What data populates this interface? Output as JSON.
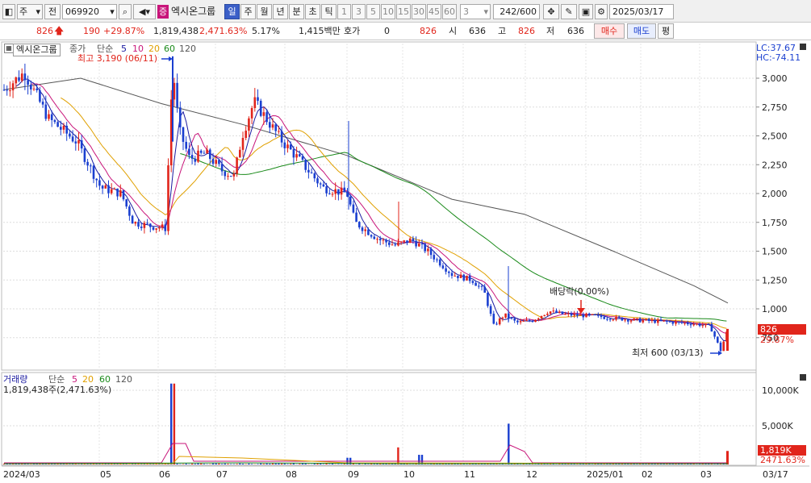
{
  "toolbar": {
    "market_type": "주",
    "market_sub": "전",
    "code": "069920",
    "stock_name": "엑시온그룹",
    "name_badge": "증",
    "period_buttons": [
      "일",
      "주",
      "월",
      "년",
      "분",
      "초",
      "틱"
    ],
    "interval_buttons": [
      "1",
      "3",
      "5",
      "10",
      "15",
      "30",
      "45",
      "60"
    ],
    "interval_select": "3",
    "count": "242",
    "count_max": "/600",
    "date": "2025/03/17"
  },
  "quote": {
    "price": "826",
    "change": "190",
    "change_pct": "+29.87%",
    "volume": "1,819,438",
    "volume_pct": "2,471.63%",
    "turnover": "5.17%",
    "amount": "1,415백만",
    "hoga_label": "호가",
    "hoga_value": "0",
    "hoga_price": "826",
    "open_label": "시",
    "open": "636",
    "high_label": "고",
    "high": "826",
    "low_label": "저",
    "low": "636",
    "buy": "매수",
    "sell": "매도",
    "avg": "평"
  },
  "price_panel": {
    "legend_name": "엑시온그룹",
    "legend_close": "종가",
    "legend_simple": "단순",
    "ma": [
      "5",
      "10",
      "20",
      "60",
      "120"
    ],
    "high_label": "최고 3,190 (06/11)",
    "low_label": "최저 600 (03/13)",
    "dividend_label": "배당락(0.00%)",
    "lc": "LC:37.67",
    "hc": "HC:-74.11",
    "axis_ticks": [
      "3,000",
      "2,750",
      "2,500",
      "2,250",
      "2,000",
      "1,750",
      "1,500",
      "1,250",
      "1,000",
      "750"
    ],
    "cur_price": "826",
    "cur_pct": "29.87%"
  },
  "volume_panel": {
    "legend_name": "거래량",
    "legend_simple": "단순",
    "ma": [
      "5",
      "20",
      "60",
      "120"
    ],
    "volume_text": "1,819,438주(2,471.63%)",
    "axis_ticks": [
      "10,000K",
      "5,000K"
    ],
    "cur_volume": "1,819K",
    "cur_pct": "2471.63%"
  },
  "x_axis": [
    "2024/03",
    "05",
    "06",
    "07",
    "08",
    "09",
    "10",
    "11",
    "12",
    "2025/01",
    "02",
    "03"
  ],
  "x_axis_right": "03/17",
  "colors": {
    "up": "#e1251b",
    "down": "#1a3fd0",
    "ma5": "#1a1aa0",
    "ma10": "#c8157a",
    "ma20": "#e0a000",
    "ma60": "#1a8a1a",
    "ma120": "#555555"
  }
}
